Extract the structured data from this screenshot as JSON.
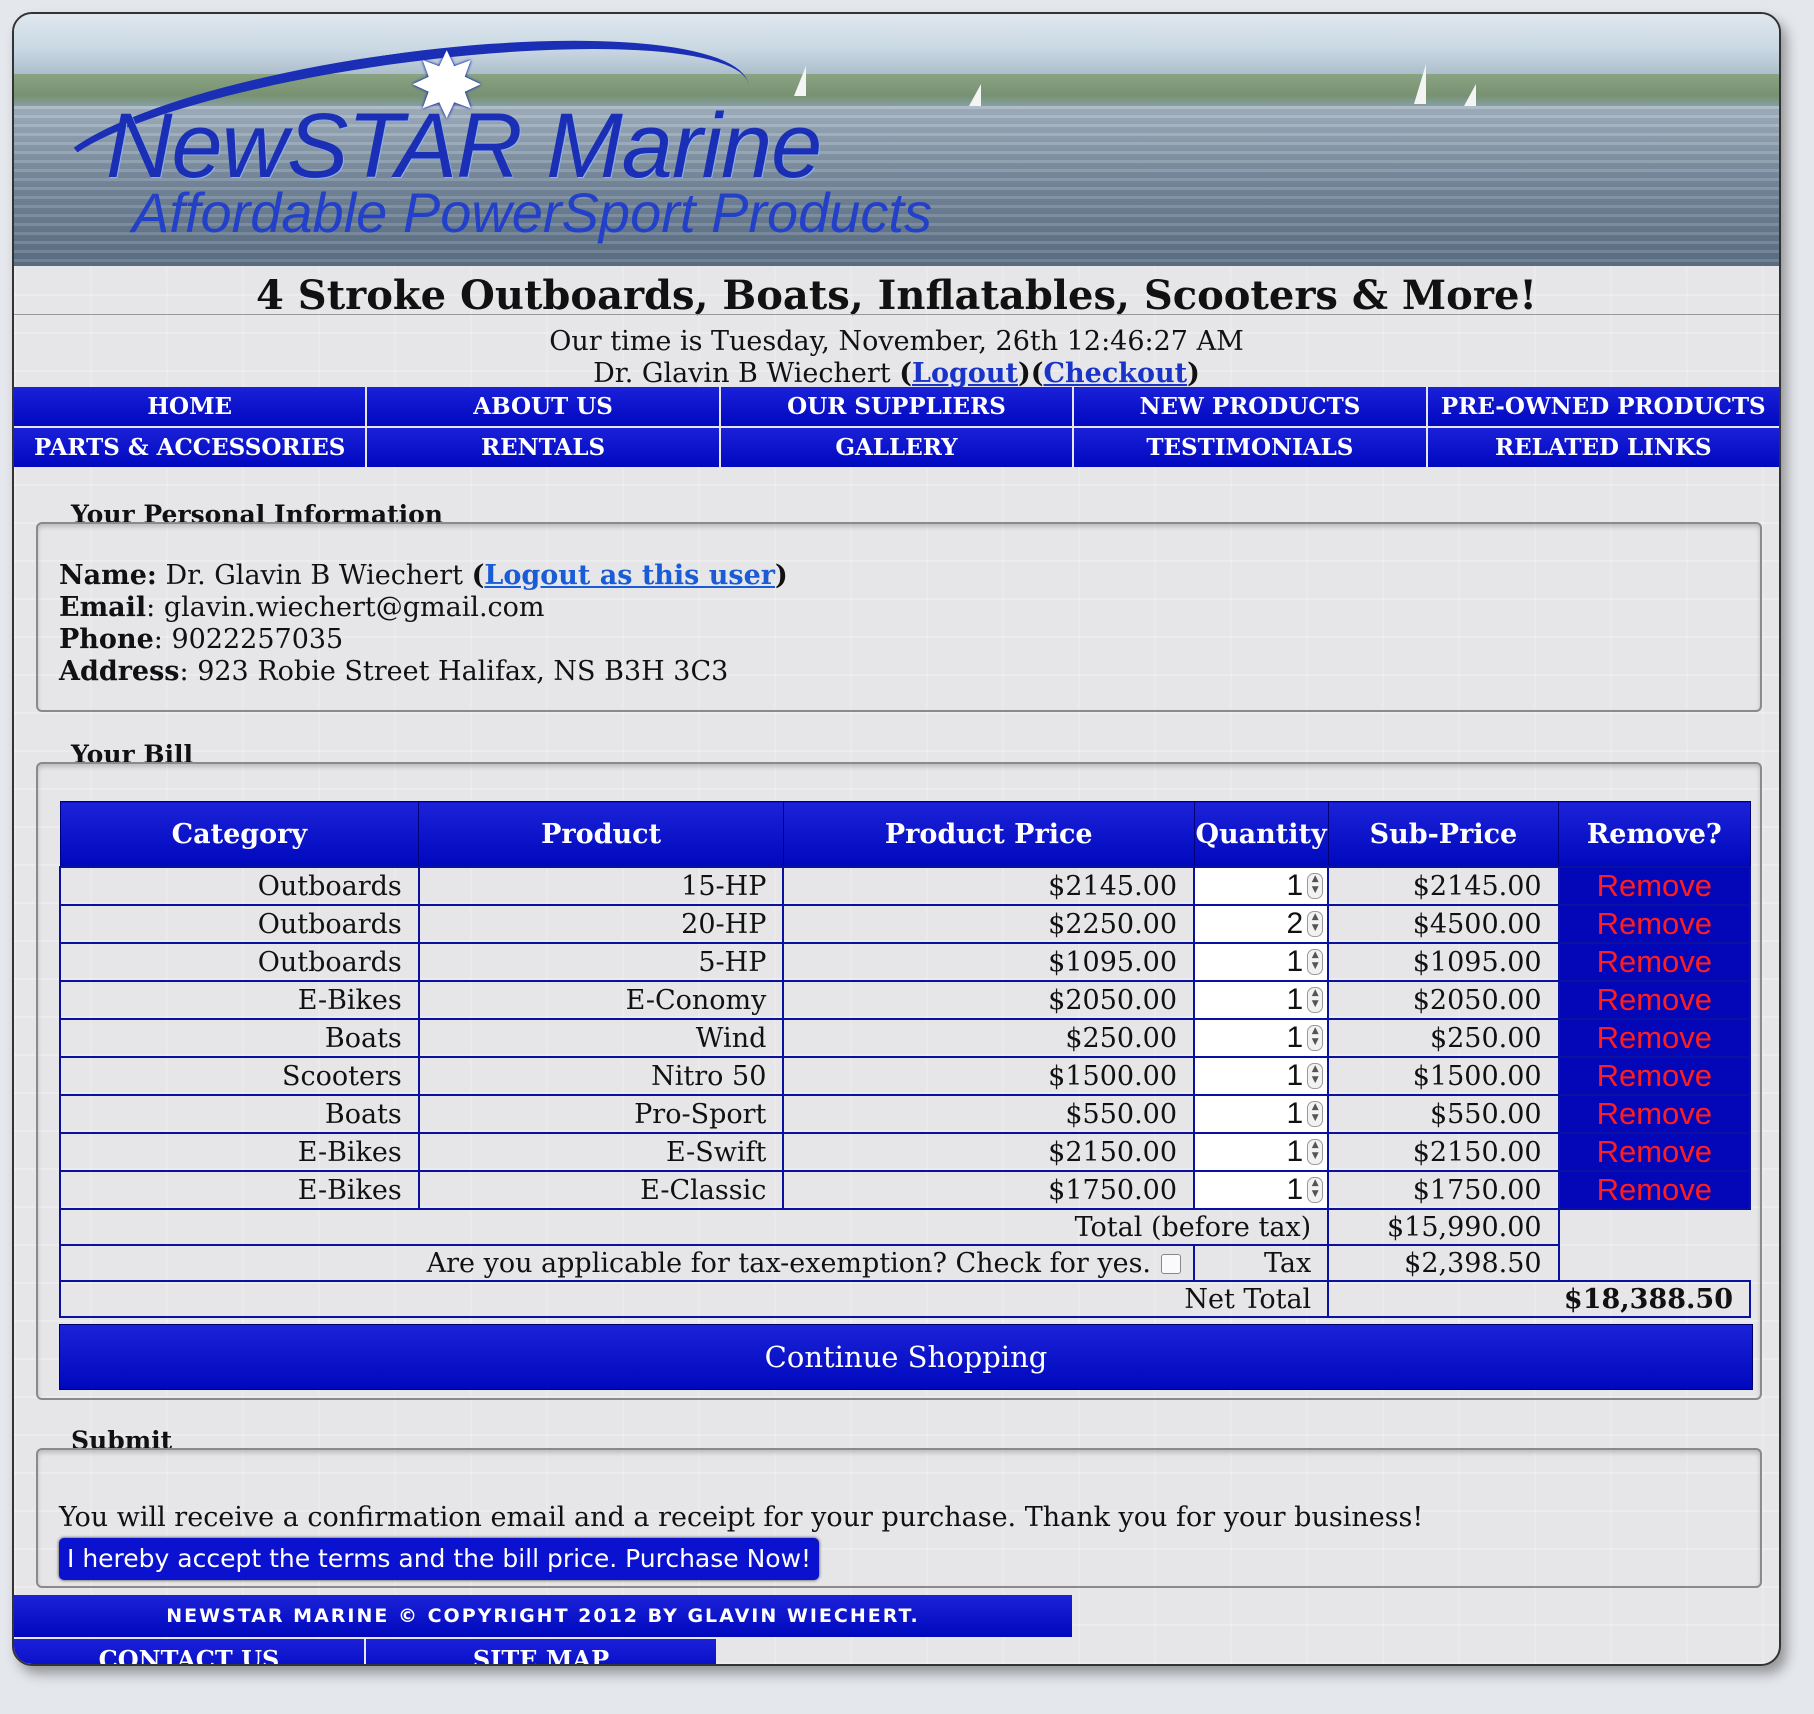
{
  "brand": {
    "name": "NewSTAR Marine",
    "subtitle": "Affordable PowerSport Products"
  },
  "tagline": "4 Stroke Outboards, Boats, Inflatables, Scooters & More!",
  "time_text": "Our time is Tuesday, November, 26th 12:46:27 AM",
  "user": {
    "name": "Dr. Glavin B Wiechert",
    "logout_label": "Logout",
    "checkout_label": "Checkout"
  },
  "nav": [
    "HOME",
    "ABOUT US",
    "OUR SUPPLIERS",
    "NEW PRODUCTS",
    "PRE-OWNED PRODUCTS",
    "PARTS & ACCESSORIES",
    "RENTALS",
    "GALLERY",
    "TESTIMONIALS",
    "RELATED LINKS"
  ],
  "personal": {
    "legend": "Your Personal Information",
    "name_label": "Name:",
    "name": "Dr. Glavin B Wiechert",
    "logout_as_label": "Logout as this user",
    "email_label": "Email",
    "email": "glavin.wiechert@gmail.com",
    "phone_label": "Phone",
    "phone": "9022257035",
    "address_label": "Address",
    "address": "923 Robie Street Halifax, NS B3H 3C3"
  },
  "bill": {
    "legend": "Your Bill",
    "headers": [
      "Category",
      "Product",
      "Product Price",
      "Quantity",
      "Sub-Price",
      "Remove?"
    ],
    "rows": [
      {
        "category": "Outboards",
        "product": "15-HP",
        "price": "$2145.00",
        "qty": "1",
        "sub": "$2145.00",
        "remove": "Remove"
      },
      {
        "category": "Outboards",
        "product": "20-HP",
        "price": "$2250.00",
        "qty": "2",
        "sub": "$4500.00",
        "remove": "Remove"
      },
      {
        "category": "Outboards",
        "product": "5-HP",
        "price": "$1095.00",
        "qty": "1",
        "sub": "$1095.00",
        "remove": "Remove"
      },
      {
        "category": "E-Bikes",
        "product": "E-Conomy",
        "price": "$2050.00",
        "qty": "1",
        "sub": "$2050.00",
        "remove": "Remove"
      },
      {
        "category": "Boats",
        "product": "Wind",
        "price": "$250.00",
        "qty": "1",
        "sub": "$250.00",
        "remove": "Remove"
      },
      {
        "category": "Scooters",
        "product": "Nitro 50",
        "price": "$1500.00",
        "qty": "1",
        "sub": "$1500.00",
        "remove": "Remove"
      },
      {
        "category": "Boats",
        "product": "Pro-Sport",
        "price": "$550.00",
        "qty": "1",
        "sub": "$550.00",
        "remove": "Remove"
      },
      {
        "category": "E-Bikes",
        "product": "E-Swift",
        "price": "$2150.00",
        "qty": "1",
        "sub": "$2150.00",
        "remove": "Remove"
      },
      {
        "category": "E-Bikes",
        "product": "E-Classic",
        "price": "$1750.00",
        "qty": "1",
        "sub": "$1750.00",
        "remove": "Remove"
      }
    ],
    "total_label": "Total (before tax)",
    "total": "$15,990.00",
    "tax_exempt_question": "Are you applicable for tax-exemption? Check for yes.",
    "tax_exempt_checked": false,
    "tax_label": "Tax",
    "tax": "$2,398.50",
    "net_label": "Net Total",
    "net": "$18,388.50",
    "continue_label": "Continue Shopping"
  },
  "submit": {
    "legend": "Submit",
    "message": "You will receive a confirmation email and a receipt for your purchase. Thank you for your business!",
    "button": "I hereby accept the terms and the bill price. Purchase Now!"
  },
  "footer": {
    "copyright": "NEWSTAR MARINE © COPYRIGHT 2012 BY GLAVIN WIECHERT.",
    "links": [
      "CONTACT US",
      "SITE MAP"
    ]
  },
  "colors": {
    "nav_blue": "#0008c0",
    "remove_red": "#ff1e1e",
    "link_blue": "#1a5cd6"
  }
}
